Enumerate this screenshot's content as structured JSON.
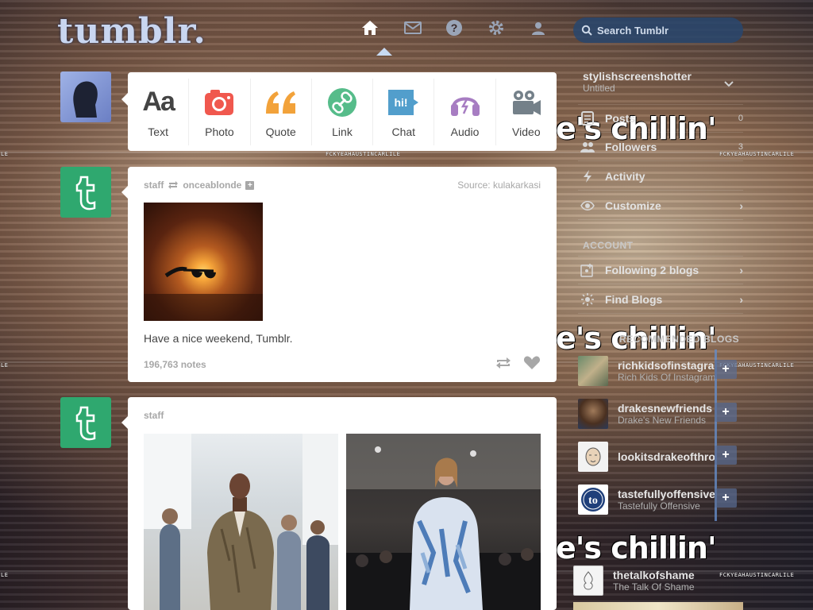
{
  "header": {
    "logo": "tumblr.",
    "search_placeholder": "Search Tumblr",
    "nav": [
      {
        "name": "home-icon",
        "active": true
      },
      {
        "name": "mail-icon"
      },
      {
        "name": "help-icon"
      },
      {
        "name": "gear-icon"
      },
      {
        "name": "user-icon"
      }
    ]
  },
  "background": {
    "caption": "e's chillin'",
    "watermark": "FCKYEAHAUSTINCARLILE",
    "edge_watermark": "LE"
  },
  "post_types": [
    {
      "label": "Text",
      "icon": "text-icon",
      "color": "#444444"
    },
    {
      "label": "Photo",
      "icon": "camera-icon",
      "color": "#f0584e"
    },
    {
      "label": "Quote",
      "icon": "quote-icon",
      "color": "#f2a23a"
    },
    {
      "label": "Link",
      "icon": "link-icon",
      "color": "#56bc8a"
    },
    {
      "label": "Chat",
      "icon": "chat-icon",
      "color": "#529ecc"
    },
    {
      "label": "Audio",
      "icon": "headphones-icon",
      "color": "#a77dc2"
    },
    {
      "label": "Video",
      "icon": "video-camera-icon",
      "color": "#748089"
    }
  ],
  "posts": [
    {
      "author": "staff",
      "reblogged_from": "onceablonde",
      "source_label": "Source:",
      "source": "kulakarkasi",
      "caption": "Have a nice weekend, Tumblr.",
      "notes": "196,763 notes"
    },
    {
      "author": "staff"
    }
  ],
  "sidebar": {
    "blog_name": "stylishscreenshotter",
    "blog_subtitle": "Untitled",
    "rows": [
      {
        "label": "Posts",
        "count": "0",
        "icon": "posts-icon"
      },
      {
        "label": "Followers",
        "count": "3",
        "icon": "followers-icon"
      },
      {
        "label": "Activity",
        "icon": "activity-icon"
      },
      {
        "label": "Customize",
        "icon": "eye-icon",
        "chevron": true
      }
    ],
    "account_header": "ACCOUNT",
    "account_rows": [
      {
        "label": "Following 2 blogs",
        "icon": "following-icon"
      },
      {
        "label": "Find Blogs",
        "icon": "find-blogs-icon"
      }
    ],
    "recommended_header": "RECOMMENDED BLOGS",
    "recommended": [
      {
        "name": "richkidsofinstagram",
        "subtitle": "Rich Kids Of Instagram"
      },
      {
        "name": "drakesnewfriends",
        "subtitle": "Drake's New Friends"
      },
      {
        "name": "lookitsdrakeofthrones",
        "subtitle": ""
      },
      {
        "name": "tastefullyoffensive",
        "subtitle": "Tastefully Offensive"
      }
    ],
    "radar": {
      "name": "thetalkofshame",
      "subtitle": "The Talk Of Shame"
    }
  }
}
